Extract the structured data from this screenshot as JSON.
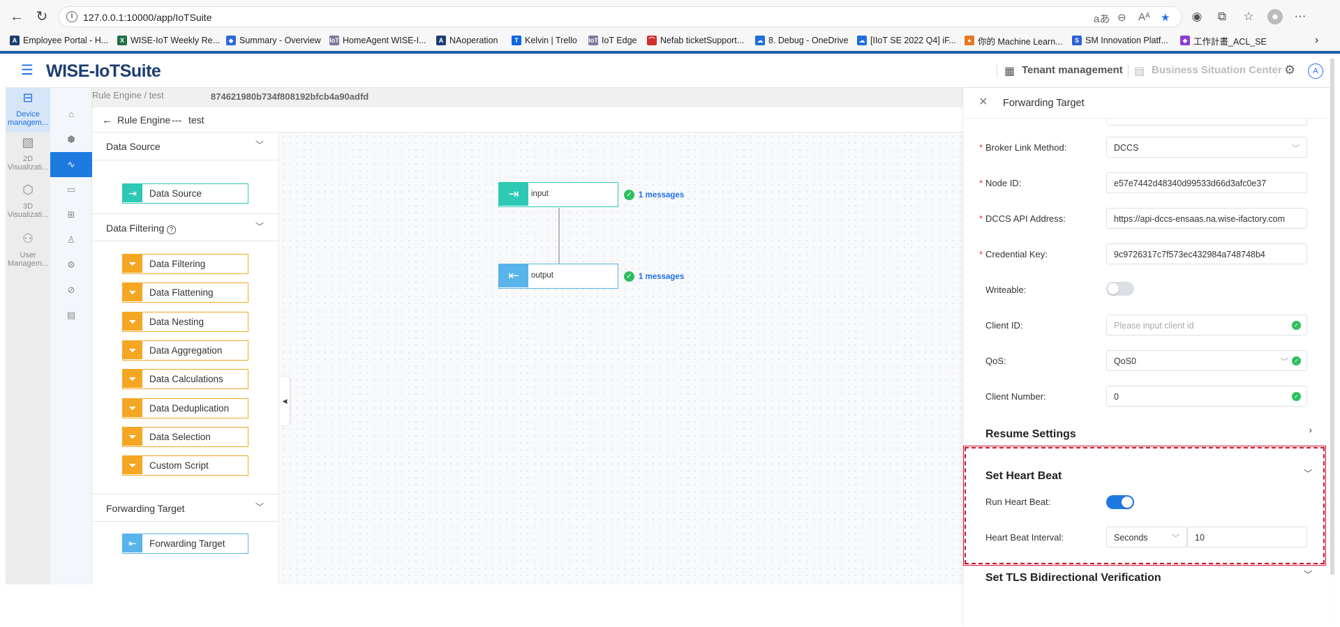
{
  "browser": {
    "url": "127.0.0.1:10000/app/IoTSuite",
    "bookmarks": [
      {
        "label": "Employee Portal - H...",
        "icon": "A",
        "color": "#1d3e73"
      },
      {
        "label": "WISE-IoT Weekly Re...",
        "icon": "X",
        "color": "#1e7145"
      },
      {
        "label": "Summary - Overview",
        "icon": "◆",
        "color": "#2b6cd8"
      },
      {
        "label": "HomeAgent WISE-I...",
        "icon": "IoT",
        "color": "#7a7a9a"
      },
      {
        "label": "NAoperation",
        "icon": "A",
        "color": "#1d3e73"
      },
      {
        "label": "Kelvin | Trello",
        "icon": "T",
        "color": "#0c66e4"
      },
      {
        "label": "IoT Edge",
        "icon": "IoT",
        "color": "#7a7a9a"
      },
      {
        "label": "Nefab ticketSupport...",
        "icon": "⌒",
        "color": "#d0312d"
      },
      {
        "label": "8. Debug - OneDrive",
        "icon": "☁",
        "color": "#1e6fd9"
      },
      {
        "label": "[IIoT SE 2022 Q4] iF...",
        "icon": "☁",
        "color": "#1e6fd9"
      },
      {
        "label": "你的 Machine Learn...",
        "icon": "●",
        "color": "#e87722"
      },
      {
        "label": "SM Innovation Platf...",
        "icon": "S",
        "color": "#2b5fd9"
      },
      {
        "label": "工作計畫_ACL_SE",
        "icon": "◆",
        "color": "#8b3fd1"
      }
    ]
  },
  "header": {
    "logo": "WISE-IoTSuite",
    "tenant_management": "Tenant management",
    "business_center": "Business Situation Center",
    "avatar": "A"
  },
  "left_nav": [
    {
      "label": "Device managem...",
      "icon": "device-icon"
    },
    {
      "label": "2D Visualizati...",
      "icon": "chart-icon"
    },
    {
      "label": "3D Visualizati...",
      "icon": "cube-icon"
    },
    {
      "label": "User Managem...",
      "icon": "users-icon"
    }
  ],
  "breadcrumb": {
    "root": "Rule Engine",
    "child": "test",
    "id": "874621980b734f808192bfcb4a90adfd"
  },
  "title_row": {
    "back_label": "Rule Engine",
    "sep": "---",
    "name": "test"
  },
  "node_panel": {
    "data_source": {
      "title": "Data Source",
      "items": [
        "Data Source"
      ]
    },
    "data_filtering": {
      "title": "Data Filtering",
      "items": [
        "Data Filtering",
        "Data Flattening",
        "Data Nesting",
        "Data Aggregation",
        "Data Calculations",
        "Data Deduplication",
        "Data Selection",
        "Custom Script"
      ]
    },
    "forwarding_target": {
      "title": "Forwarding Target",
      "items": [
        "Forwarding Target"
      ]
    }
  },
  "canvas": {
    "input_node": {
      "label": "input",
      "messages": "1 messages"
    },
    "output_node": {
      "label": "output",
      "messages": "1 messages"
    }
  },
  "drawer": {
    "title": "Forwarding Target",
    "fields": {
      "broker_link_method": {
        "label": "Broker Link Method:",
        "value": "DCCS"
      },
      "node_id": {
        "label": "Node ID:",
        "value": "e57e7442d48340d99533d66d3afc0e37"
      },
      "dccs_api_address": {
        "label": "DCCS API Address:",
        "value": "https://api-dccs-ensaas.na.wise-ifactory.com"
      },
      "credential_key": {
        "label": "Credential Key:",
        "value": "9c9726317c7f573ec432984a748748b4"
      },
      "writeable": {
        "label": "Writeable:",
        "value": false
      },
      "client_id": {
        "label": "Client ID:",
        "placeholder": "Please input client id"
      },
      "qos": {
        "label": "QoS:",
        "value": "QoS0"
      },
      "client_number": {
        "label": "Client Number:",
        "value": "0"
      }
    },
    "resume_settings": {
      "title": "Resume Settings"
    },
    "heart_beat": {
      "title": "Set Heart Beat",
      "run_label": "Run Heart Beat:",
      "run_value": true,
      "interval_label": "Heart Beat Interval:",
      "interval_unit": "Seconds",
      "interval_value": "10"
    },
    "tls": {
      "title": "Set TLS Bidirectional Verification"
    }
  }
}
